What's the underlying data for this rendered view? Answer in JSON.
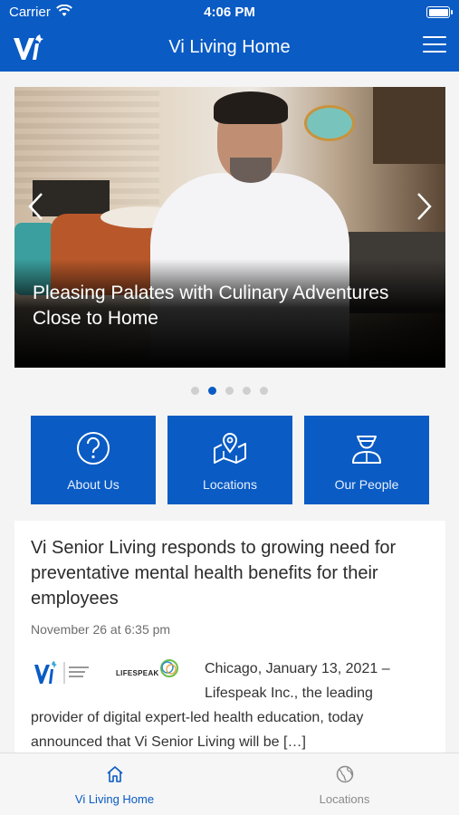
{
  "status_bar": {
    "carrier": "Carrier",
    "time": "4:06 PM"
  },
  "nav": {
    "title": "Vi Living Home",
    "menu_icon": "hamburger-menu-icon",
    "logo_icon": "vi-logo-icon"
  },
  "carousel": {
    "caption": "Pleasing Palates with Culinary Adventures Close to Home",
    "slide_count": 5,
    "active_slide": 2
  },
  "tiles": [
    {
      "label": "About Us",
      "icon": "question-circle-icon"
    },
    {
      "label": "Locations",
      "icon": "map-pin-icon"
    },
    {
      "label": "Our People",
      "icon": "person-icon"
    }
  ],
  "article": {
    "headline": "Vi Senior Living responds to growing need for preventative mental health benefits for their employees",
    "date": "November 26 at 6:35 pm",
    "body_top": "Chicago, January 13, 2021 – Lifespeak Inc., the leading",
    "body_rest": "provider of digital expert-led health education, today announced that Vi Senior Living will be […]",
    "logo_text": "LIFESPEAK"
  },
  "tab_bar": [
    {
      "label": "Vi Living Home",
      "icon": "home-icon",
      "active": true
    },
    {
      "label": "Locations",
      "icon": "globe-icon",
      "active": false
    }
  ],
  "colors": {
    "brand_blue": "#0a5bc4",
    "inactive_gray": "#8a8a8a"
  }
}
